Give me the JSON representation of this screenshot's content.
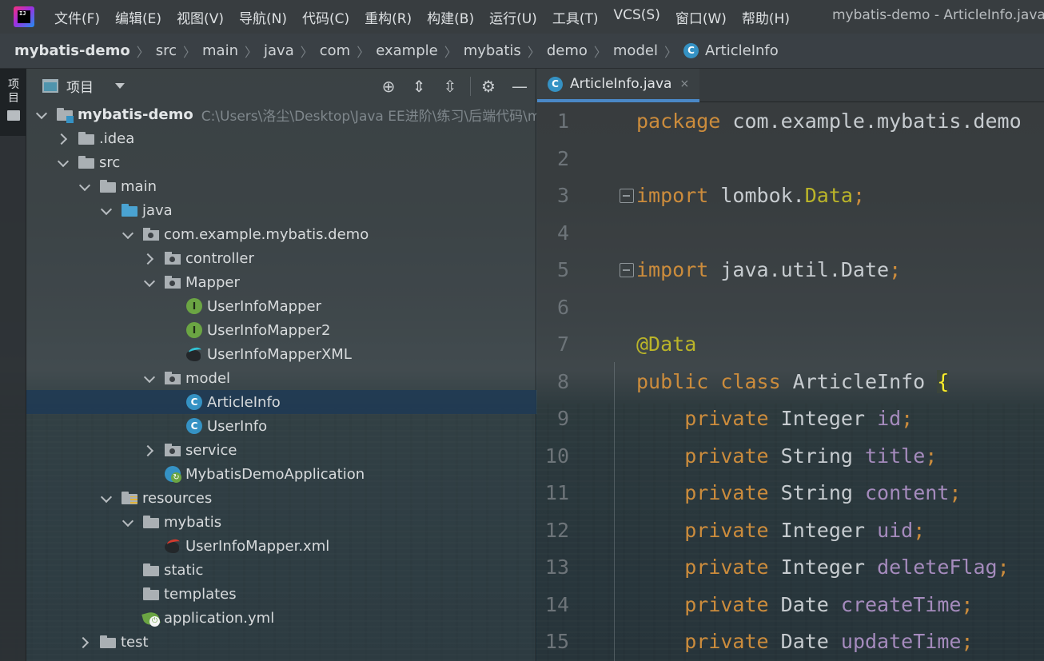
{
  "window": {
    "title": "mybatis-demo - ArticleInfo.java"
  },
  "menu": [
    "文件(F)",
    "编辑(E)",
    "视图(V)",
    "导航(N)",
    "代码(C)",
    "重构(R)",
    "构建(B)",
    "运行(U)",
    "工具(T)",
    "VCS(S)",
    "窗口(W)",
    "帮助(H)"
  ],
  "breadcrumb": [
    "mybatis-demo",
    "src",
    "main",
    "java",
    "com",
    "example",
    "mybatis",
    "demo",
    "model",
    "ArticleInfo"
  ],
  "tool_strip": {
    "project_label": "项目"
  },
  "project_panel": {
    "title": "项目",
    "tools": {
      "locate": "⊕",
      "expand": "⇕",
      "collapse": "⇳",
      "settings": "⚙",
      "hide": "—"
    }
  },
  "tree": [
    {
      "label": "mybatis-demo",
      "path": "C:\\Users\\洛尘\\Desktop\\Java EE进阶\\练习\\后端代码\\m",
      "icon": "module-folder-icon",
      "arrow": "down",
      "depth": 0,
      "bold": true
    },
    {
      "label": ".idea",
      "icon": "folder-icon",
      "arrow": "right",
      "depth": 1
    },
    {
      "label": "src",
      "icon": "folder-icon",
      "arrow": "down",
      "depth": 1
    },
    {
      "label": "main",
      "icon": "folder-icon",
      "arrow": "down",
      "depth": 2
    },
    {
      "label": "java",
      "icon": "source-folder-icon",
      "arrow": "down",
      "depth": 3
    },
    {
      "label": "com.example.mybatis.demo",
      "icon": "package-icon",
      "arrow": "down",
      "depth": 4
    },
    {
      "label": "controller",
      "icon": "package-icon",
      "arrow": "right",
      "depth": 5
    },
    {
      "label": "Mapper",
      "icon": "package-icon",
      "arrow": "down",
      "depth": 5
    },
    {
      "label": "UserInfoMapper",
      "icon": "interface-icon",
      "arrow": "none",
      "depth": 6
    },
    {
      "label": "UserInfoMapper2",
      "icon": "interface-icon",
      "arrow": "none",
      "depth": 6
    },
    {
      "label": "UserInfoMapperXML",
      "icon": "mybatis-bird-icon",
      "arrow": "none",
      "depth": 6
    },
    {
      "label": "model",
      "icon": "package-icon",
      "arrow": "down",
      "depth": 5
    },
    {
      "label": "ArticleInfo",
      "icon": "class-icon",
      "arrow": "none",
      "depth": 6,
      "selected": true
    },
    {
      "label": "UserInfo",
      "icon": "class-icon",
      "arrow": "none",
      "depth": 6
    },
    {
      "label": "service",
      "icon": "package-icon",
      "arrow": "right",
      "depth": 5
    },
    {
      "label": "MybatisDemoApplication",
      "icon": "spring-boot-app-icon",
      "arrow": "none",
      "depth": 5
    },
    {
      "label": "resources",
      "icon": "resources-folder-icon",
      "arrow": "down",
      "depth": 3
    },
    {
      "label": "mybatis",
      "icon": "folder-icon",
      "arrow": "down",
      "depth": 4
    },
    {
      "label": "UserInfoMapper.xml",
      "icon": "mybatis-xml-icon",
      "arrow": "none",
      "depth": 5
    },
    {
      "label": "static",
      "icon": "folder-icon",
      "arrow": "none",
      "depth": 4
    },
    {
      "label": "templates",
      "icon": "folder-icon",
      "arrow": "none",
      "depth": 4
    },
    {
      "label": "application.yml",
      "icon": "spring-yml-icon",
      "arrow": "none",
      "depth": 4
    },
    {
      "label": "test",
      "icon": "folder-icon",
      "arrow": "right",
      "depth": 2
    }
  ],
  "editor": {
    "tab": {
      "label": "ArticleInfo.java",
      "close": "×",
      "icon_letter": "C"
    },
    "lines": [
      {
        "n": "1",
        "tokens": [
          [
            "kw",
            "package"
          ],
          [
            "plain",
            " com.example.mybatis.demo"
          ]
        ]
      },
      {
        "n": "2",
        "tokens": []
      },
      {
        "n": "3",
        "fold": true,
        "tokens": [
          [
            "kw",
            "import"
          ],
          [
            "plain",
            " lombok."
          ],
          [
            "ann",
            "Data"
          ],
          [
            "semi",
            ";"
          ]
        ]
      },
      {
        "n": "4",
        "tokens": []
      },
      {
        "n": "5",
        "fold": true,
        "tokens": [
          [
            "kw",
            "import"
          ],
          [
            "plain",
            " java.util.Date"
          ],
          [
            "semi",
            ";"
          ]
        ]
      },
      {
        "n": "6",
        "tokens": []
      },
      {
        "n": "7",
        "tokens": [
          [
            "ann",
            "@Data"
          ]
        ]
      },
      {
        "n": "8",
        "tokens": [
          [
            "kw",
            "public class "
          ],
          [
            "plain",
            "ArticleInfo "
          ],
          [
            "brace",
            "{"
          ]
        ]
      },
      {
        "n": "9",
        "tokens": [
          [
            "plain",
            "    "
          ],
          [
            "kw",
            "private "
          ],
          [
            "plain",
            "Integer "
          ],
          [
            "field",
            "id"
          ],
          [
            "semi",
            ";"
          ]
        ]
      },
      {
        "n": "10",
        "tokens": [
          [
            "plain",
            "    "
          ],
          [
            "kw",
            "private "
          ],
          [
            "plain",
            "String "
          ],
          [
            "field",
            "title"
          ],
          [
            "semi",
            ";"
          ]
        ]
      },
      {
        "n": "11",
        "tokens": [
          [
            "plain",
            "    "
          ],
          [
            "kw",
            "private "
          ],
          [
            "plain",
            "String "
          ],
          [
            "field",
            "content"
          ],
          [
            "semi",
            ";"
          ]
        ]
      },
      {
        "n": "12",
        "tokens": [
          [
            "plain",
            "    "
          ],
          [
            "kw",
            "private "
          ],
          [
            "plain",
            "Integer "
          ],
          [
            "field",
            "uid"
          ],
          [
            "semi",
            ";"
          ]
        ]
      },
      {
        "n": "13",
        "tokens": [
          [
            "plain",
            "    "
          ],
          [
            "kw",
            "private "
          ],
          [
            "plain",
            "Integer "
          ],
          [
            "field",
            "deleteFlag"
          ],
          [
            "semi",
            ";"
          ]
        ]
      },
      {
        "n": "14",
        "tokens": [
          [
            "plain",
            "    "
          ],
          [
            "kw",
            "private "
          ],
          [
            "plain",
            "Date "
          ],
          [
            "field",
            "createTime"
          ],
          [
            "semi",
            ";"
          ]
        ]
      },
      {
        "n": "15",
        "tokens": [
          [
            "plain",
            "    "
          ],
          [
            "kw",
            "private "
          ],
          [
            "plain",
            "Date "
          ],
          [
            "field",
            "updateTime"
          ],
          [
            "semi",
            ";"
          ]
        ]
      }
    ]
  },
  "colors": {
    "keyword": "#cc8c3c",
    "annotation": "#bbb529",
    "field": "#a58bbd",
    "selection": "#1f3a55",
    "tab_underline": "#4a88c7",
    "class_icon": "#3592c4",
    "interface_icon": "#6ba543"
  }
}
